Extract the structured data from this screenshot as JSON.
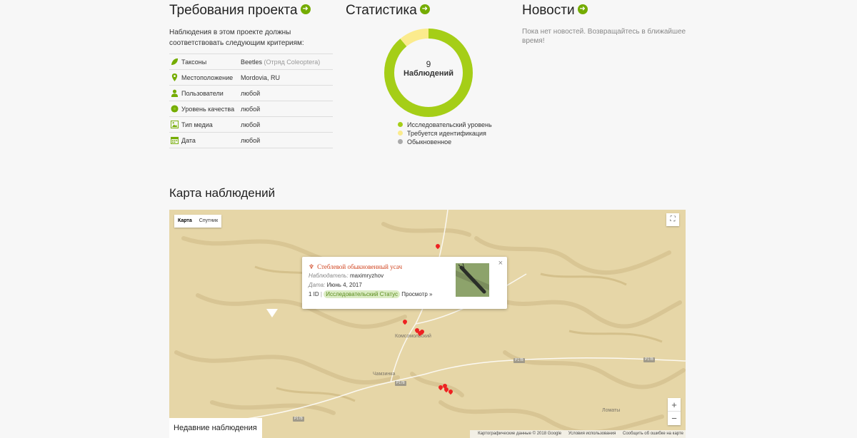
{
  "requirements": {
    "title": "Требования проекта",
    "intro": "Наблюдения в этом проекте должны соответствовать следующим критериям:",
    "rows": [
      {
        "icon": "leaf-icon",
        "key": "Таксоны",
        "value": "Beetles",
        "extra": "(Отряд Coleoptera)"
      },
      {
        "icon": "location-pin-icon",
        "key": "Местоположение",
        "value": "Mordovia, RU",
        "extra": ""
      },
      {
        "icon": "user-icon",
        "key": "Пользователи",
        "value": "любой",
        "extra": ""
      },
      {
        "icon": "quality-badge-icon",
        "key": "Уровень качества",
        "value": "любой",
        "extra": ""
      },
      {
        "icon": "media-icon",
        "key": "Тип медиа",
        "value": "любой",
        "extra": ""
      },
      {
        "icon": "calendar-icon",
        "key": "Дата",
        "value": "любой",
        "extra": ""
      }
    ]
  },
  "stats": {
    "title": "Статистика",
    "count": "9",
    "count_label": "Наблюдений",
    "breakdown": [
      {
        "label": "Исследовательский уровень",
        "value": 8,
        "color": "#a5ce17"
      },
      {
        "label": "Требуется идентификация",
        "value": 1,
        "color": "#fbeb8d"
      },
      {
        "label": "Обыкновенное",
        "value": 0,
        "color": "#aaaaaa"
      }
    ]
  },
  "news": {
    "title": "Новости",
    "empty": "Пока нет новостей. Возвращайтесь в ближайшее время!"
  },
  "map": {
    "title": "Карта наблюдений",
    "type_map": "Карта",
    "type_satellite": "Спутник",
    "places": {
      "komsomolsky": "Комсомольский",
      "chamzinka": "Чамзинка",
      "lomaty": "Ломаты"
    },
    "roads": {
      "r178a": "P178",
      "r178b": "P178",
      "r178c": "P178",
      "r178d": "P178"
    },
    "attribution": {
      "data": "Картографические данные © 2018 Google",
      "terms": "Условия использования",
      "report": "Сообщить об ошибке на карте"
    },
    "recent": "Недавние наблюдения",
    "zoom_in": "+",
    "zoom_out": "−",
    "popup": {
      "title": "Стеблевой обыкновенный усач",
      "observer_label": "Наблюдатель:",
      "observer": "maximryzhov",
      "date_label": "Дата:",
      "date": "Июнь 4, 2017",
      "ids": "1 ID",
      "sep": "|",
      "status": "Исследовательский Статус",
      "view": "Просмотр »",
      "close": "×"
    }
  },
  "colors": {
    "accent": "#74ac00",
    "map_bg": "#e6d6a7"
  }
}
